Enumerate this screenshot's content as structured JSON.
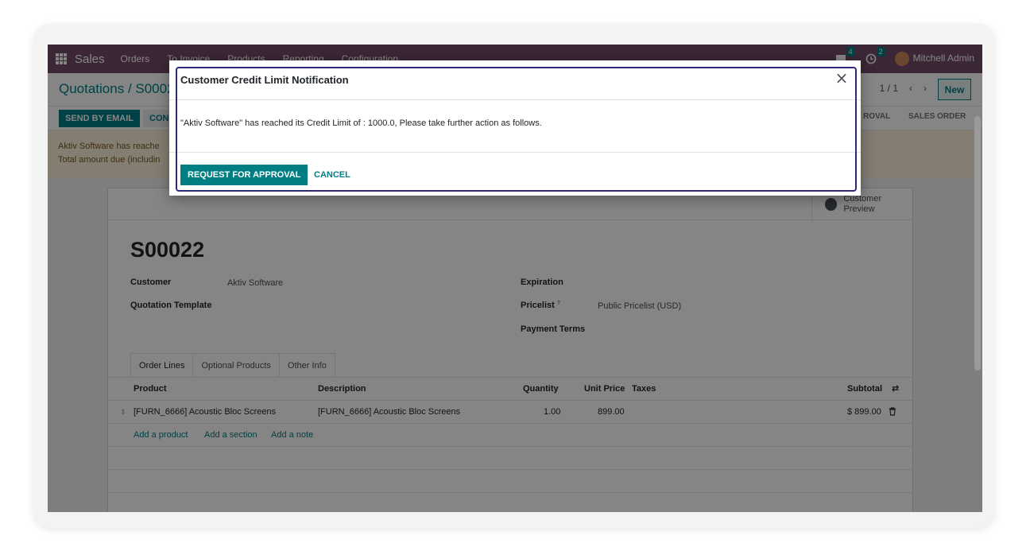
{
  "navbar": {
    "app_name": "Sales",
    "menu": [
      "Orders",
      "To Invoice",
      "Products",
      "Reporting",
      "Configuration"
    ],
    "messages_count": "4",
    "activities_count": "2",
    "user_name": "Mitchell Admin"
  },
  "control_panel": {
    "breadcrumb": "Quotations / S0002",
    "pager": "1 / 1",
    "prev": "‹",
    "next": "›",
    "new_label": "New"
  },
  "statusbar": {
    "send_by_email": "SEND BY EMAIL",
    "confirm": "CON",
    "stage_approval": "ROVAL",
    "stage_sales_order": "SALES ORDER"
  },
  "alert": {
    "line1": "Aktiv Software has reache",
    "line2": "Total amount due (includin"
  },
  "form": {
    "smart_button": "Customer Preview",
    "record_name": "S00022",
    "customer_label": "Customer",
    "customer_value": "Aktiv Software",
    "template_label": "Quotation Template",
    "expiration_label": "Expiration",
    "pricelist_label": "Pricelist",
    "pricelist_help": "?",
    "pricelist_value": "Public Pricelist (USD)",
    "payment_terms_label": "Payment Terms",
    "tabs": [
      "Order Lines",
      "Optional Products",
      "Other Info"
    ],
    "table": {
      "headers": {
        "product": "Product",
        "description": "Description",
        "quantity": "Quantity",
        "unit_price": "Unit Price",
        "taxes": "Taxes",
        "subtotal": "Subtotal"
      },
      "row": {
        "product": "[FURN_6666] Acoustic Bloc Screens",
        "description": "[FURN_6666] Acoustic Bloc Screens",
        "quantity": "1.00",
        "unit_price": "899.00",
        "subtotal": "$ 899.00"
      },
      "add_product": "Add a product",
      "add_section": "Add a section",
      "add_note": "Add a note"
    }
  },
  "modal": {
    "title": "Customer Credit Limit Notification",
    "message": "\"Aktiv Software\" has reached its Credit Limit of : 1000.0, Please take further action as follows.",
    "approve_label": "REQUEST FOR APPROVAL",
    "cancel_label": "CANCEL",
    "close_symbol": "×"
  },
  "colors": {
    "navbar": "#714b67",
    "primary": "#017e84",
    "alert_bg": "#fbefdb",
    "modal_outline": "#2e2a7a"
  }
}
